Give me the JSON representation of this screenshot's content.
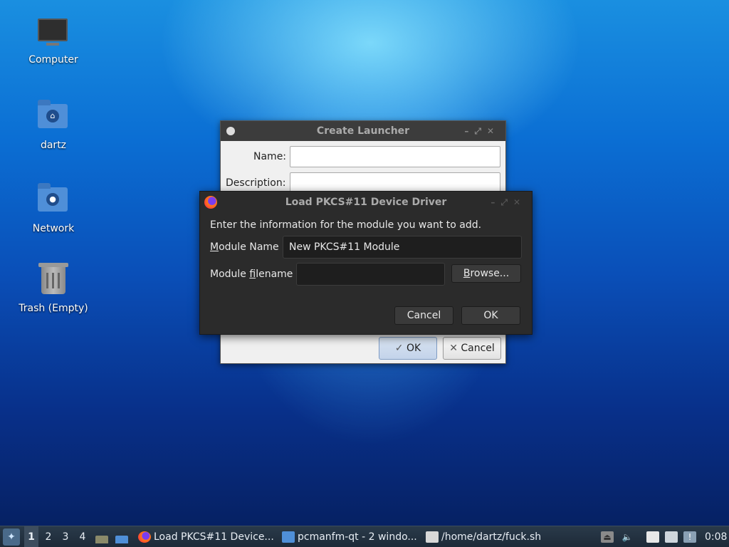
{
  "desktop": {
    "icons": [
      {
        "label": "Computer",
        "icon": "computer-icon"
      },
      {
        "label": "dartz",
        "icon": "home-folder-icon"
      },
      {
        "label": "Network",
        "icon": "network-folder-icon"
      },
      {
        "label": "Trash (Empty)",
        "icon": "trash-icon"
      }
    ]
  },
  "launcher": {
    "title": "Create Launcher",
    "name_label": "Name:",
    "name_value": "",
    "description_label": "Description:",
    "description_value": "",
    "ok_label": "OK",
    "cancel_label": "Cancel"
  },
  "pkcs": {
    "title": "Load PKCS#11 Device Driver",
    "instruction": "Enter the information for the module you want to add.",
    "module_name_label_ul": "M",
    "module_name_label_rest": "odule Name",
    "module_name_value": "New PKCS#11 Module",
    "module_filename_label_pre": "Module ",
    "module_filename_label_ul": "f",
    "module_filename_label_rest": "ilename",
    "module_filename_value": "",
    "browse_ul": "B",
    "browse_rest": "rowse...",
    "cancel_label": "Cancel",
    "ok_label": "OK"
  },
  "taskbar": {
    "workspaces": [
      "1",
      "2",
      "3",
      "4"
    ],
    "tasks": [
      {
        "label": "Load PKCS#11 Device...",
        "icon": "firefox-icon"
      },
      {
        "label": "pcmanfm-qt - 2 windo...",
        "icon": "folder-icon"
      },
      {
        "label": "/home/dartz/fuck.sh",
        "icon": "text-editor-icon"
      }
    ],
    "clock": "0:08"
  },
  "colors": {
    "dialog_bg": "#2b2b2b",
    "taskbar_bg": "#1d2a38",
    "accent": "#4f8fd8"
  }
}
